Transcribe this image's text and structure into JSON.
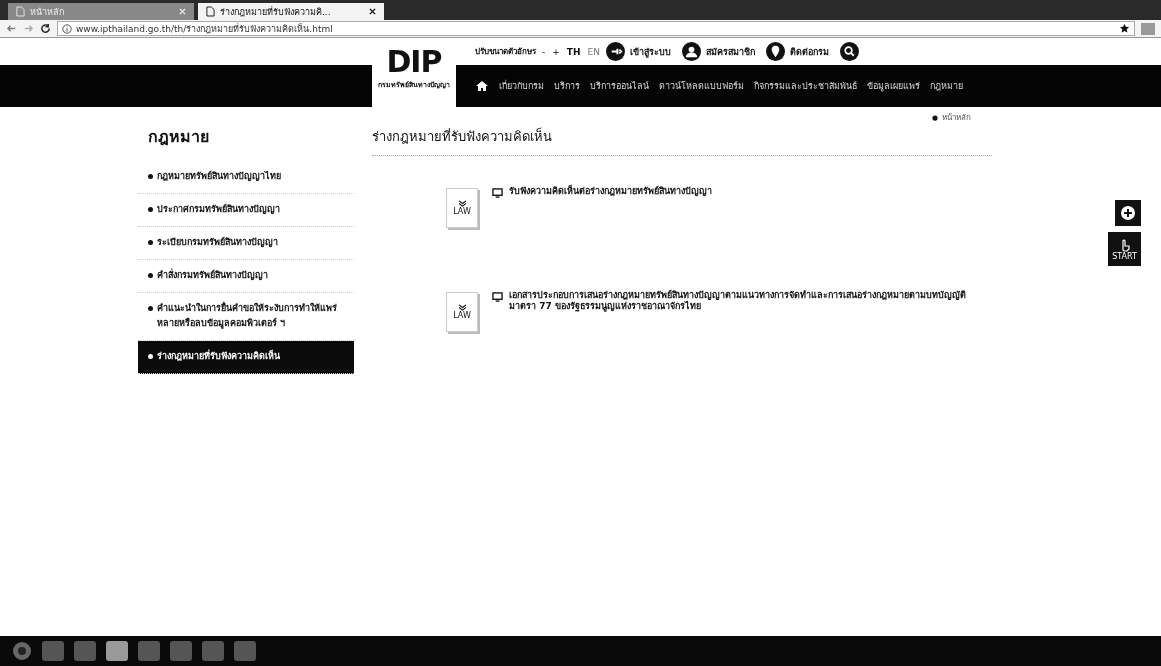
{
  "browser": {
    "tabs": [
      {
        "label": "หน้าหลัก",
        "selected": false
      },
      {
        "label": "ร่างกฎหมายที่รับฟังความคิ...",
        "selected": true
      }
    ],
    "url": "www.ipthailand.go.th/th/ร่างกฎหมายที่รับฟังความคิดเห็น.html"
  },
  "logo": {
    "text": "DIP",
    "subtitle": "กรมทรัพย์สินทางปัญญา"
  },
  "topbar": {
    "font_size_label": "ปรับขนาดตัวอักษร",
    "minus": "-",
    "plus": "+",
    "languages": [
      {
        "label": "TH",
        "selected": true
      },
      {
        "label": "EN",
        "selected": false
      }
    ],
    "links": [
      {
        "kind": "login",
        "label": "เข้าสู่ระบบ"
      },
      {
        "kind": "register",
        "label": "สมัครสมาชิก"
      },
      {
        "kind": "contact",
        "label": "ติดต่อกรม"
      }
    ]
  },
  "nav": [
    "เกี่ยวกับกรม",
    "บริการ",
    "บริการออนไลน์",
    "ดาวน์โหลดแบบฟอร์ม",
    "กิจกรรมและประชาสัมพันธ์",
    "ข้อมูลเผยแพร่",
    "กฎหมาย"
  ],
  "breadcrumb": "หน้าหลัก",
  "sidebar": {
    "title": "กฎหมาย",
    "items": [
      {
        "label": "กฎหมายทรัพย์สินทางปัญญาไทย",
        "selected": false
      },
      {
        "label": "ประกาศกรมทรัพย์สินทางปัญญา",
        "selected": false
      },
      {
        "label": "ระเบียบกรมทรัพย์สินทางปัญญา",
        "selected": false
      },
      {
        "label": "คำสั่งกรมทรัพย์สินทางปัญญา",
        "selected": false
      },
      {
        "label": "คำแนะนำในการยื่นคำขอให้ระงับการทำให้แพร่หลายหรือลบข้อมูลคอมพิวเตอร์ ฯ",
        "selected": false
      },
      {
        "label": "ร่างกฎหมายที่รับฟังความคิดเห็น",
        "selected": true
      }
    ]
  },
  "main": {
    "title": "ร่างกฎหมายที่รับฟังความคิดเห็น",
    "documents": [
      {
        "badge": "LAW",
        "title": "รับฟังความคิดเห็นต่อร่างกฎหมายทรัพย์สินทางปัญญา"
      },
      {
        "badge": "LAW",
        "title": "เอกสารประกอบการเสนอร่างกฎหมายทรัพย์สินทางปัญญาตามแนวทางการจัดทำและการเสนอร่างกฎหมายตามบทบัญญัติมาตรา 77 ของรัฐธรรมนูญแห่งราชอาณาจักรไทย"
      }
    ]
  },
  "start_button": "START"
}
